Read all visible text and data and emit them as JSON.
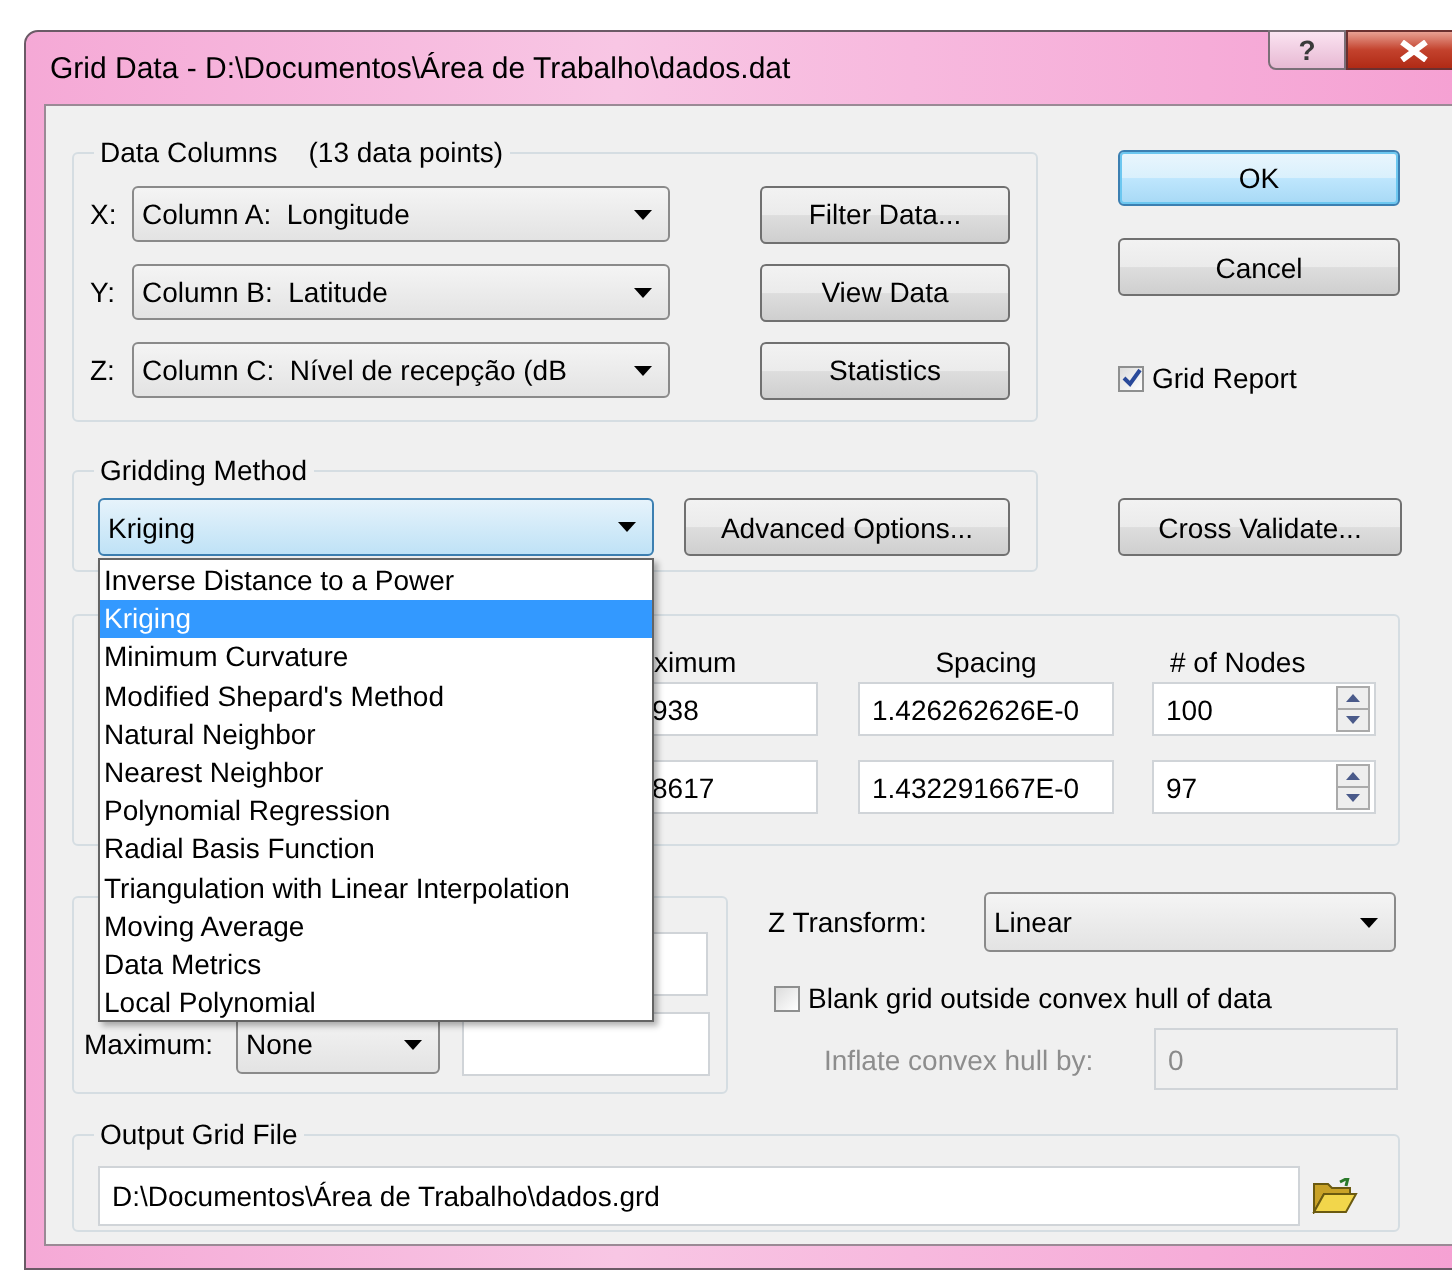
{
  "window": {
    "title": "Grid Data - D:\\Documentos\\Área de Trabalho\\dados.dat",
    "help_button": "?"
  },
  "data_columns": {
    "title": "Data Columns",
    "count": "(13 data points)",
    "rows": [
      {
        "axis": "X:",
        "value": "Column A:  Longitude"
      },
      {
        "axis": "Y:",
        "value": "Column B:  Latitude"
      },
      {
        "axis": "Z:",
        "value": "Column C:  Nível de recepção (dB"
      }
    ],
    "buttons": [
      "Filter Data...",
      "View Data",
      "Statistics"
    ]
  },
  "ok_button": "OK",
  "cancel_button": "Cancel",
  "grid_report": {
    "label": "Grid Report",
    "checked": true
  },
  "gridding_method": {
    "title": "Gridding Method",
    "value": "Kriging",
    "advanced_button": "Advanced Options...",
    "options": [
      {
        "label": "Inverse Distance to a Power",
        "selected": false
      },
      {
        "label": "Kriging",
        "selected": true
      },
      {
        "label": "Minimum Curvature",
        "selected": false
      },
      {
        "label": "Modified Shepard's Method",
        "selected": false
      },
      {
        "label": "Natural Neighbor",
        "selected": false
      },
      {
        "label": "Nearest Neighbor",
        "selected": false
      },
      {
        "label": "Polynomial Regression",
        "selected": false
      },
      {
        "label": "Radial Basis Function",
        "selected": false
      },
      {
        "label": "Triangulation with Linear Interpolation",
        "selected": false
      },
      {
        "label": "Moving Average",
        "selected": false
      },
      {
        "label": "Data Metrics",
        "selected": false
      },
      {
        "label": "Local Polynomial",
        "selected": false
      }
    ]
  },
  "cross_validate_button": "Cross Validate...",
  "grid_line_geometry": {
    "columns": [
      "ximum",
      "Spacing",
      "# of Nodes"
    ],
    "rows": [
      {
        "maximum": "938",
        "spacing": "1.426262626E-0",
        "nodes": "100"
      },
      {
        "maximum": "8617",
        "spacing": "1.432291667E-0",
        "nodes": "97"
      }
    ]
  },
  "blanking": {
    "maximum_label": "Maximum:",
    "maximum_value": "None"
  },
  "z_transform": {
    "label": "Z Transform:",
    "value": "Linear"
  },
  "blank_outside_hull": {
    "label": "Blank grid outside convex hull of data",
    "checked": false
  },
  "inflate_hull": {
    "label": "Inflate convex hull by:",
    "value": "0",
    "disabled": true
  },
  "output_grid_file": {
    "title": "Output Grid File",
    "path": "D:\\Documentos\\Área de Trabalho\\dados.grd"
  }
}
